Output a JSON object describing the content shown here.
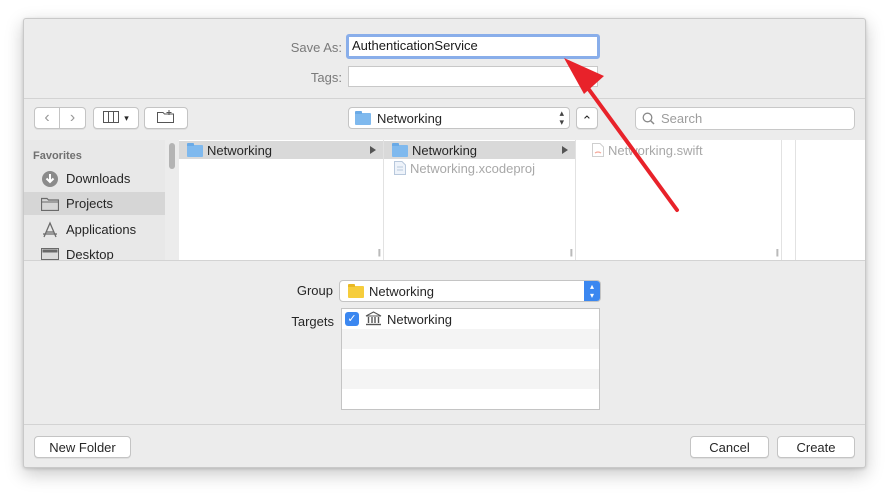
{
  "save_as": {
    "label": "Save As:",
    "value": "AuthenticationService"
  },
  "tags": {
    "label": "Tags:",
    "value": ""
  },
  "toolbar": {
    "back": "‹",
    "forward": "›",
    "view_mode": "view-columns",
    "new_folder_icon": "folder-plus",
    "location": "Networking",
    "collapse": "⌃",
    "search_placeholder": "Search"
  },
  "sidebar": {
    "heading": "Favorites",
    "items": [
      {
        "label": "Downloads",
        "icon": "download-circle"
      },
      {
        "label": "Projects",
        "icon": "folder"
      },
      {
        "label": "Applications",
        "icon": "applications"
      },
      {
        "label": "Desktop",
        "icon": "desktop"
      }
    ]
  },
  "columns": [
    {
      "items": [
        {
          "label": "Networking",
          "type": "folder",
          "selected": true,
          "has_children": true
        }
      ]
    },
    {
      "items": [
        {
          "label": "Networking",
          "type": "folder",
          "selected": true,
          "has_children": true
        },
        {
          "label": "Networking.xcodeproj",
          "type": "file",
          "dimmed": true
        }
      ]
    },
    {
      "items": [
        {
          "label": "Networking.swift",
          "type": "swift",
          "dimmed": true
        }
      ]
    }
  ],
  "group": {
    "label": "Group",
    "value": "Networking"
  },
  "targets": {
    "label": "Targets",
    "items": [
      {
        "label": "Networking",
        "checked": true
      }
    ]
  },
  "footer": {
    "new_folder": "New Folder",
    "cancel": "Cancel",
    "create": "Create"
  },
  "colors": {
    "focus_ring": "#89aeea",
    "accent": "#3b87f0",
    "annotation_arrow": "#e8222a"
  }
}
